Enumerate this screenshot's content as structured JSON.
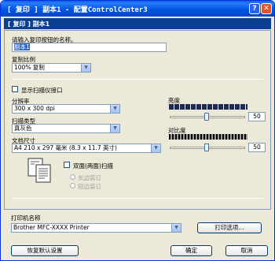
{
  "window": {
    "title": "[  复印  ]   副本1 - 配置ControlCenter3",
    "help_glyph": "?",
    "close_glyph": "✕"
  },
  "header": {
    "text": "[ 复印 ]  副本1"
  },
  "copy_name": {
    "label": "请输入复印按钮的名称。",
    "value": "副本1"
  },
  "copy_ratio": {
    "label": "复制比例",
    "value": "100% 复制"
  },
  "show_scanner_interface": {
    "label": "显示扫描仪接口",
    "checked": false
  },
  "resolution": {
    "label": "分辨率",
    "value": "300 x 300 dpi"
  },
  "scan_type": {
    "label": "扫描类型",
    "value": "真灰色"
  },
  "document_size": {
    "label": "文档尺寸",
    "value": "A4 210 x 297 毫米 (8.3 x 11.7 英寸)"
  },
  "brightness": {
    "label": "亮度",
    "value": "50"
  },
  "contrast": {
    "label": "对比度",
    "value": "50"
  },
  "duplex": {
    "label": "双面(两面)扫描",
    "checked": false,
    "options": [
      "长边装订",
      "短边装订"
    ]
  },
  "printer": {
    "label": "打印机名称",
    "value": "Brother MFC-XXXX     Printer",
    "options_button": "打印选项..."
  },
  "footer": {
    "restore_defaults": "恢复默认设置",
    "ok": "确定",
    "cancel": "取消"
  },
  "icons": {
    "dropdown_arrow": "▼",
    "duplex_doc": "duplex-document-icon"
  }
}
